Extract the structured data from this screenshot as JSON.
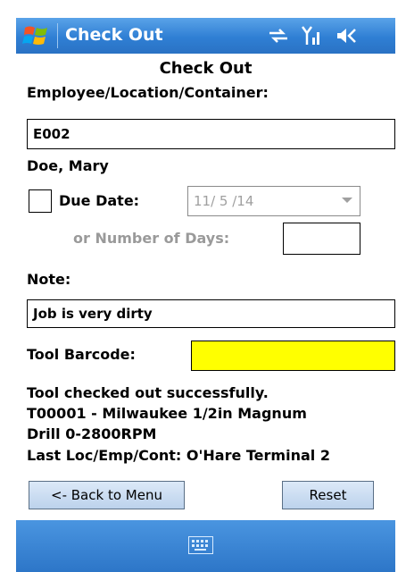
{
  "titlebar": {
    "title": "Check Out",
    "icons": [
      "windows-start-icon",
      "connectivity-icon",
      "signal-icon",
      "volume-icon"
    ]
  },
  "form": {
    "heading": "Check Out",
    "employee_label": "Employee/Location/Container:",
    "employee_value": "E002",
    "employee_name": "Doe, Mary",
    "due_date_label": "Due Date:",
    "due_date_checked": false,
    "due_date_value": "11/ 5 /14",
    "days_label": "or Number of Days:",
    "days_value": "",
    "note_label": "Note:",
    "note_value": "Job is very dirty",
    "barcode_label": "Tool Barcode:",
    "barcode_value": "",
    "barcode_bg": "#ffff00",
    "status_lines": [
      "Tool checked out successfully.",
      "T00001 - Milwaukee 1/2in Magnum",
      "Drill 0-2800RPM",
      "Last Loc/Emp/Cont:  O'Hare Terminal 2"
    ]
  },
  "buttons": {
    "back": "<- Back to Menu",
    "reset": "Reset"
  },
  "bottombar": {
    "icon": "keyboard-icon"
  }
}
